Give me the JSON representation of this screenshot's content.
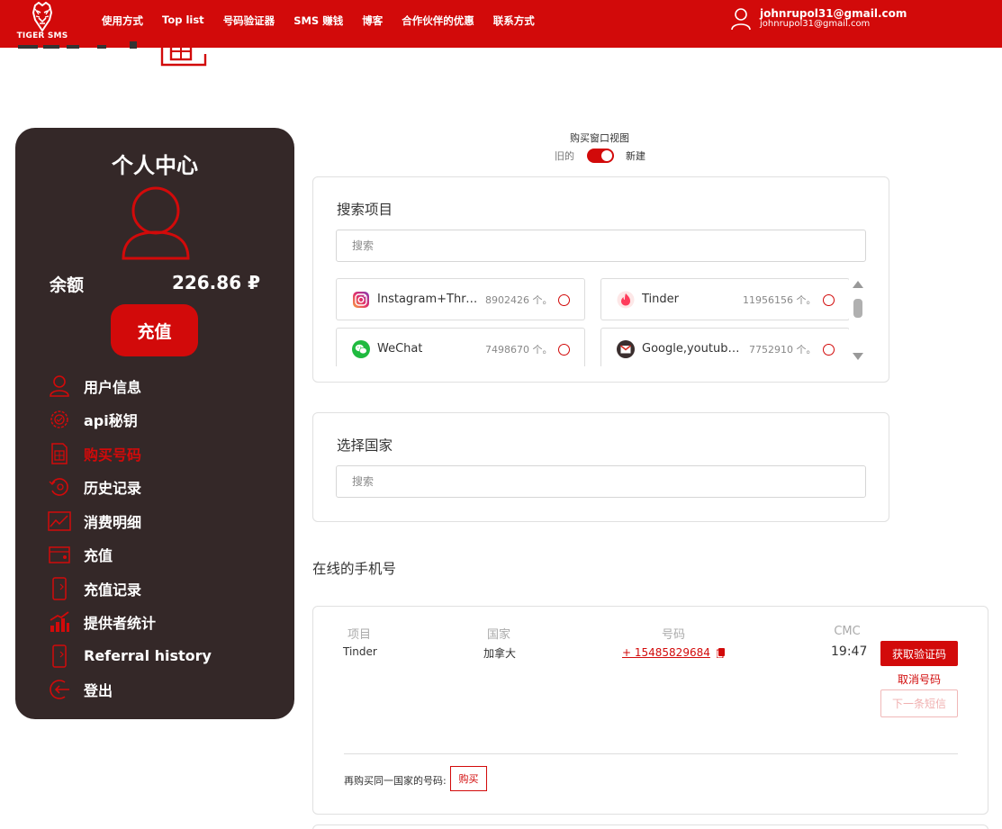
{
  "brand": {
    "name": "TIGER SMS",
    "accent": "#d20a0a",
    "sidebar_bg": "#342828"
  },
  "nav": {
    "items": [
      "使用方式",
      "Top list",
      "号码验证器",
      "SMS 赚钱",
      "博客",
      "合作伙伴的优惠",
      "联系方式"
    ]
  },
  "user": {
    "email": "johnrupol31@gmail.com",
    "email_sub": "johnrupol31@gmail.com"
  },
  "sidebar": {
    "title": "个人中心",
    "balance_label": "余额",
    "balance_value": "226.86 ₽",
    "topup_label": "充值",
    "menu": [
      {
        "label": "用户信息",
        "icon": "user-icon",
        "active": false
      },
      {
        "label": "api秘钥",
        "icon": "gear-icon",
        "active": false
      },
      {
        "label": "购买号码",
        "icon": "sim-card-icon",
        "active": true
      },
      {
        "label": "历史记录",
        "icon": "history-icon",
        "active": false
      },
      {
        "label": "消费明细",
        "icon": "chart-icon",
        "active": false
      },
      {
        "label": "充值",
        "icon": "wallet-icon",
        "active": false
      },
      {
        "label": "充值记录",
        "icon": "phone-icon",
        "active": false
      },
      {
        "label": "提供者统计",
        "icon": "bar-chart-icon",
        "active": false
      },
      {
        "label": "Referral history",
        "icon": "phone-icon",
        "active": false
      },
      {
        "label": "登出",
        "icon": "logout-icon",
        "active": false
      }
    ]
  },
  "view_toggle": {
    "title": "购买窗口视图",
    "old_label": "旧的",
    "new_label": "新建",
    "state": "new"
  },
  "search_project": {
    "title": "搜索项目",
    "placeholder": "搜索",
    "services": [
      {
        "name": "Instagram+Threads",
        "count": "8902426 个。",
        "icon": "instagram-icon"
      },
      {
        "name": "Tinder",
        "count": "11956156 个。",
        "icon": "tinder-icon"
      },
      {
        "name": "WeChat",
        "count": "7498670 个。",
        "icon": "wechat-icon"
      },
      {
        "name": "Google,youtube,Gmail",
        "count": "7752910 个。",
        "icon": "gmail-icon"
      }
    ]
  },
  "select_country": {
    "title": "选择国家",
    "placeholder": "搜索"
  },
  "online_numbers": {
    "title": "在线的手机号",
    "headers": {
      "project": "项目",
      "country": "国家",
      "number": "号码",
      "sms": "CMC"
    },
    "row": {
      "project": "Tinder",
      "country": "加拿大",
      "number": "+ 15485829684",
      "time": "19:47",
      "get_code_label": "获取验证码",
      "cancel_label": "取消号码",
      "next_sms_label": "下一条短信"
    },
    "rebuy_label": "再购买同一国家的号码:",
    "rebuy_button": "购买"
  }
}
